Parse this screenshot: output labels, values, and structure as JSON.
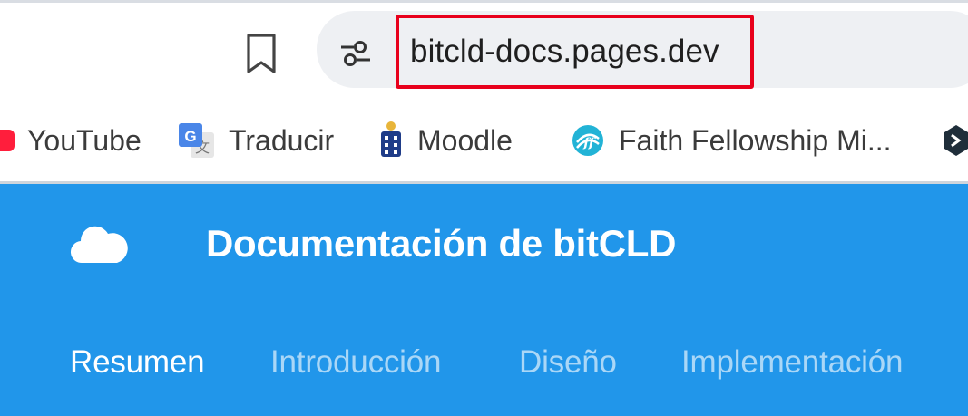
{
  "browser": {
    "address_bar": {
      "url": "bitcld-docs.pages.dev"
    },
    "bookmarks": [
      {
        "label": "YouTube",
        "icon": "youtube-icon"
      },
      {
        "label": "Traducir",
        "icon": "google-translate-icon"
      },
      {
        "label": "Moodle",
        "icon": "moodle-crest-icon"
      },
      {
        "label": "Faith Fellowship Mi...",
        "icon": "faith-fellowship-icon"
      },
      {
        "label": "",
        "icon": "hexagon-logo-icon"
      }
    ],
    "colors": {
      "highlight_border": "#e8001b",
      "omnibox_bg": "#eef0f3"
    }
  },
  "site": {
    "title": "Documentación de bitCLD",
    "logo_icon": "cloud-icon",
    "header_color": "#2196ea",
    "tabs": [
      {
        "label": "Resumen",
        "active": true
      },
      {
        "label": "Introducción",
        "active": false
      },
      {
        "label": "Diseño",
        "active": false
      },
      {
        "label": "Implementación",
        "active": false
      }
    ]
  }
}
